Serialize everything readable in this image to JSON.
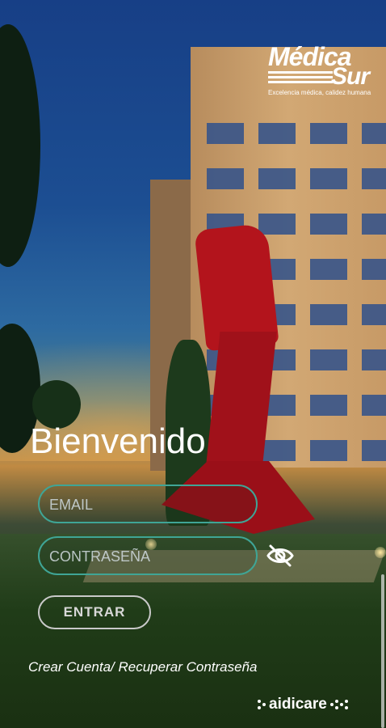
{
  "logo": {
    "line1": "Médica",
    "line2": "Sur",
    "tagline": "Excelencia médica, calidez humana"
  },
  "welcome": "Bienvenido",
  "form": {
    "email_placeholder": "EMAIL",
    "email_value": "",
    "password_placeholder": "CONTRASEÑA",
    "password_value": "",
    "submit_label": "ENTRAR",
    "toggle_visibility_icon": "eye-off-icon"
  },
  "footer": {
    "link_text": "Crear Cuenta/ Recuperar Contraseña",
    "brand": "aidicare"
  },
  "colors": {
    "field_border": "#3fa596",
    "button_border": "#c9c9c9",
    "text": "#ffffff"
  }
}
